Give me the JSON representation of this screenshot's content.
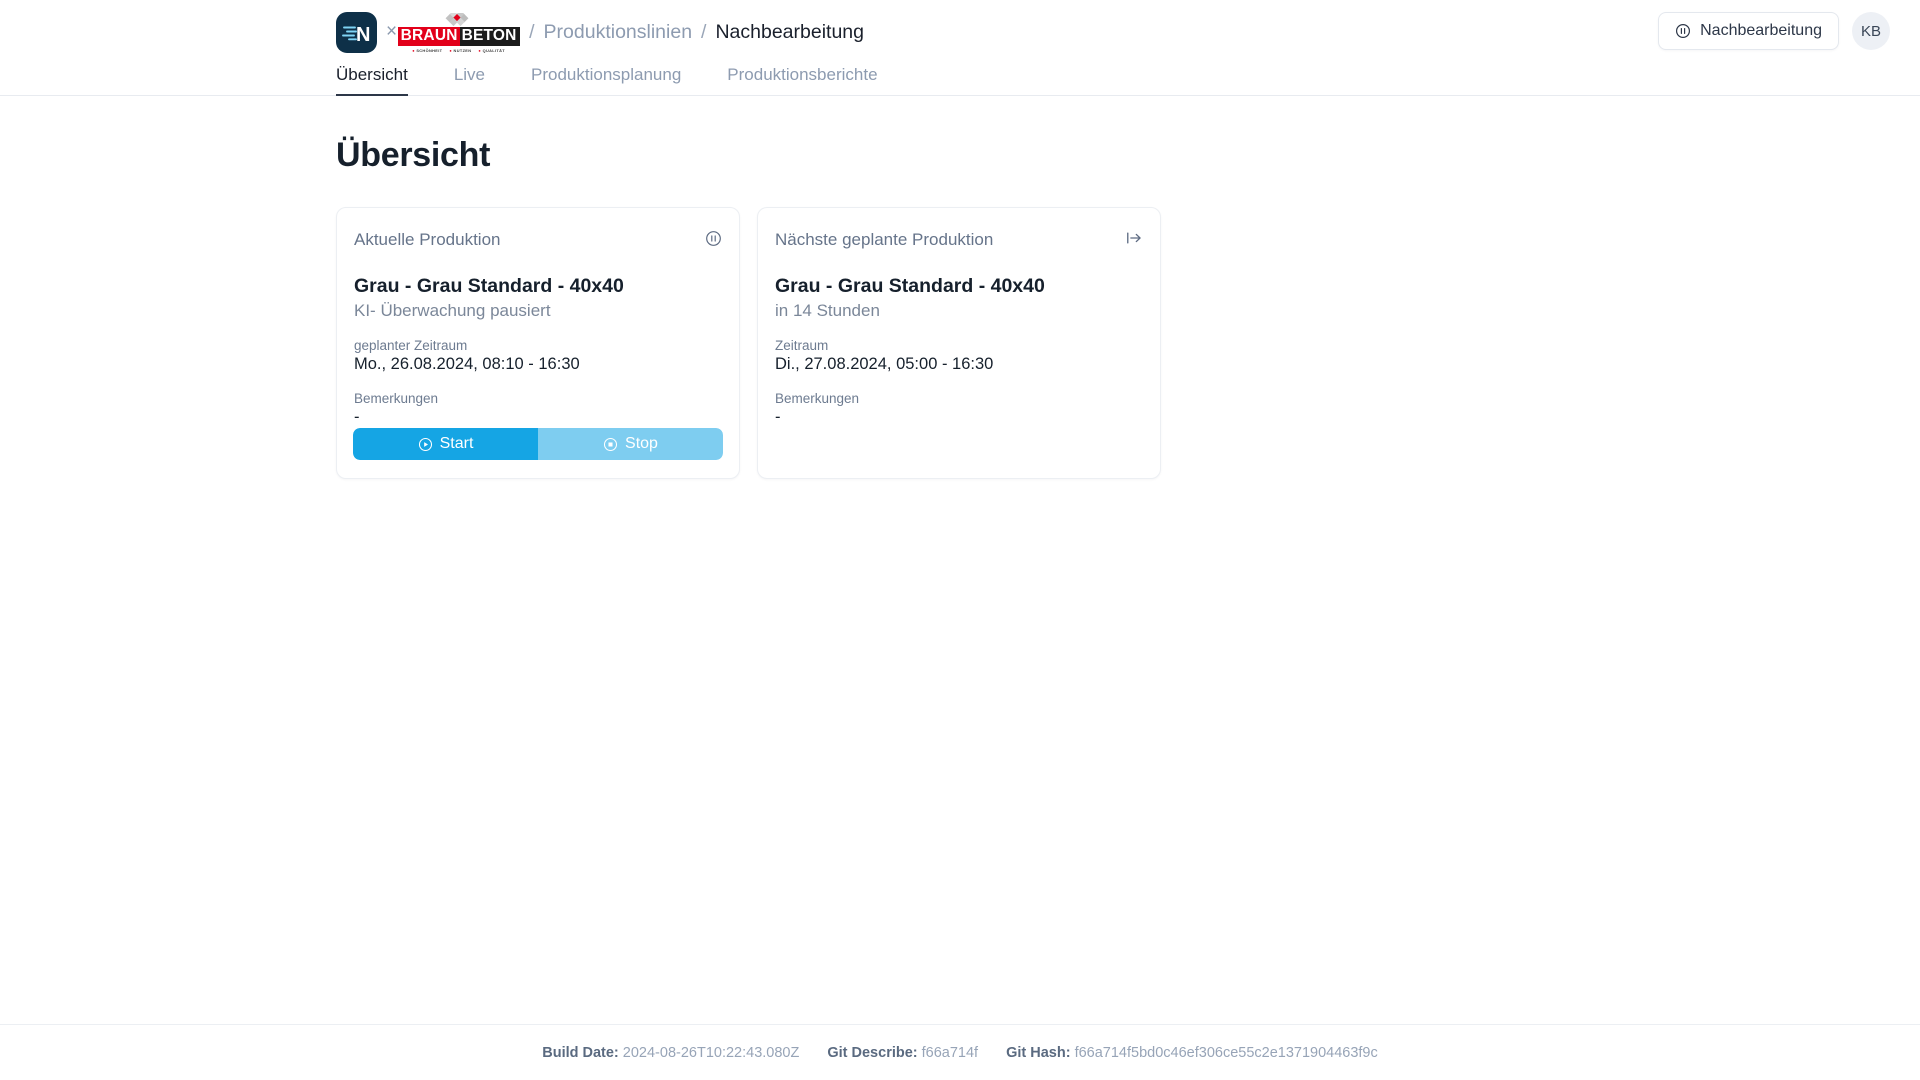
{
  "header": {
    "app_logo_letter": "N",
    "logo_separator": "×",
    "partner_logo": {
      "word1": "BRAUN",
      "word2": "BETON",
      "tagline": [
        "SCHÖNHEIT",
        "NUTZEN",
        "QUALITÄT"
      ],
      "red": "#e2001a",
      "dark": "#1b1b1b"
    },
    "breadcrumb": {
      "sep1": "/",
      "link": "Produktionslinien",
      "sep2": "/",
      "current": "Nachbearbeitung"
    },
    "status_button": {
      "icon": "pause-circle-icon",
      "label": "Nachbearbeitung"
    },
    "avatar": "KB"
  },
  "tabs": [
    {
      "label": "Übersicht",
      "active": true
    },
    {
      "label": "Live",
      "active": false
    },
    {
      "label": "Produktionsplanung",
      "active": false
    },
    {
      "label": "Produktionsberichte",
      "active": false
    }
  ],
  "main": {
    "page_title": "Übersicht",
    "cards": [
      {
        "label": "Aktuelle Produktion",
        "icon": "pause-circle-icon",
        "title": "Grau - Grau Standard - 40x40",
        "subtitle": "KI- Überwachung pausiert",
        "fields": [
          {
            "label": "geplanter Zeitraum",
            "value": "Mo., 26.08.2024, 08:10 - 16:30"
          },
          {
            "label": "Bemerkungen",
            "value": "-"
          }
        ],
        "actions": [
          {
            "label": "Start",
            "icon": "play-circle-icon",
            "color": "#15a5e4"
          },
          {
            "label": "Stop",
            "icon": "stop-circle-icon",
            "color": "#7ecdf0"
          }
        ]
      },
      {
        "label": "Nächste geplante Produktion",
        "icon": "arrow-right-from-bracket-icon",
        "title": "Grau - Grau Standard - 40x40",
        "subtitle": "in 14 Stunden",
        "fields": [
          {
            "label": "Zeitraum",
            "value": "Di., 27.08.2024, 05:00 - 16:30"
          },
          {
            "label": "Bemerkungen",
            "value": "-"
          }
        ]
      }
    ]
  },
  "footer": {
    "build_date_label": "Build Date:",
    "build_date_value": "2024-08-26T10:22:43.080Z",
    "git_describe_label": "Git Describe:",
    "git_describe_value": "f66a714f",
    "git_hash_label": "Git Hash:",
    "git_hash_value": "f66a714f5bd0c46ef306ce55c2e1371904463f9c"
  }
}
